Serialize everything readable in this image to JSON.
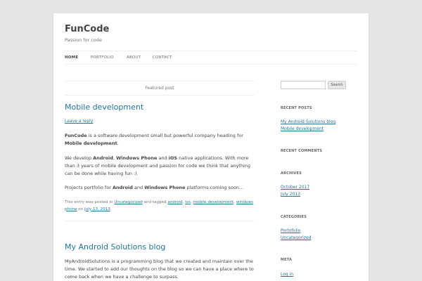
{
  "site": {
    "title": "FunCode",
    "description": "Passion for code"
  },
  "nav": {
    "home": "HOME",
    "portfolio": "PORTFOLIO",
    "about": "ABOUT",
    "contact": "CONTACT"
  },
  "featured": "Featured post",
  "post1": {
    "title": "Mobile development",
    "leave_reply": "Leave a reply",
    "p1_a": "FunCode",
    "p1_b": " is a software development small but powerful company heading for ",
    "p1_c": "Mobile development",
    "p1_d": ".",
    "p2_a": "We develop ",
    "p2_b": "Android",
    "p2_c": ", ",
    "p2_d": "Windows Phone",
    "p2_e": " and ",
    "p2_f": "iOS",
    "p2_g": " native applications. With more than 3 years of mobile development and passion for code we think that anything can be done while having fun :).",
    "p3_a": "Projects portfolio for ",
    "p3_b": "Android",
    "p3_c": " and ",
    "p3_d": "Windows Phone",
    "p3_e": " platforms coming soon…",
    "meta_a": "This entry was posted in ",
    "meta_cat": "Uncategorized",
    "meta_b": " and tagged ",
    "tag1": "android",
    "tag2": "ios",
    "tag3": "mobile development",
    "tag4": "windows phone",
    "meta_c": " on ",
    "date": "July 13, 2013",
    "meta_d": "."
  },
  "post2": {
    "title": "My Android Solutions blog",
    "body": "MyAndroidSolutions is a programming blog that we created and maintain over the time. We started to add our thoughts on the blog so we can have a place where to come back when we have a challenge to surpass."
  },
  "sidebar": {
    "search_button": "Search",
    "recent_posts_title": "RECENT POSTS",
    "recent_posts": [
      "My Android Solutions blog",
      "Mobile development"
    ],
    "recent_comments_title": "RECENT COMMENTS",
    "archives_title": "ARCHIVES",
    "archives": [
      "October 2017",
      "July 2013"
    ],
    "categories_title": "CATEGORIES",
    "categories": [
      "Portofolio",
      "Uncategorized"
    ],
    "meta_title": "META",
    "meta_links": [
      "Log in"
    ]
  },
  "colors": {
    "link": "#21759b",
    "text": "#444444",
    "background": "#e6e6e6"
  }
}
